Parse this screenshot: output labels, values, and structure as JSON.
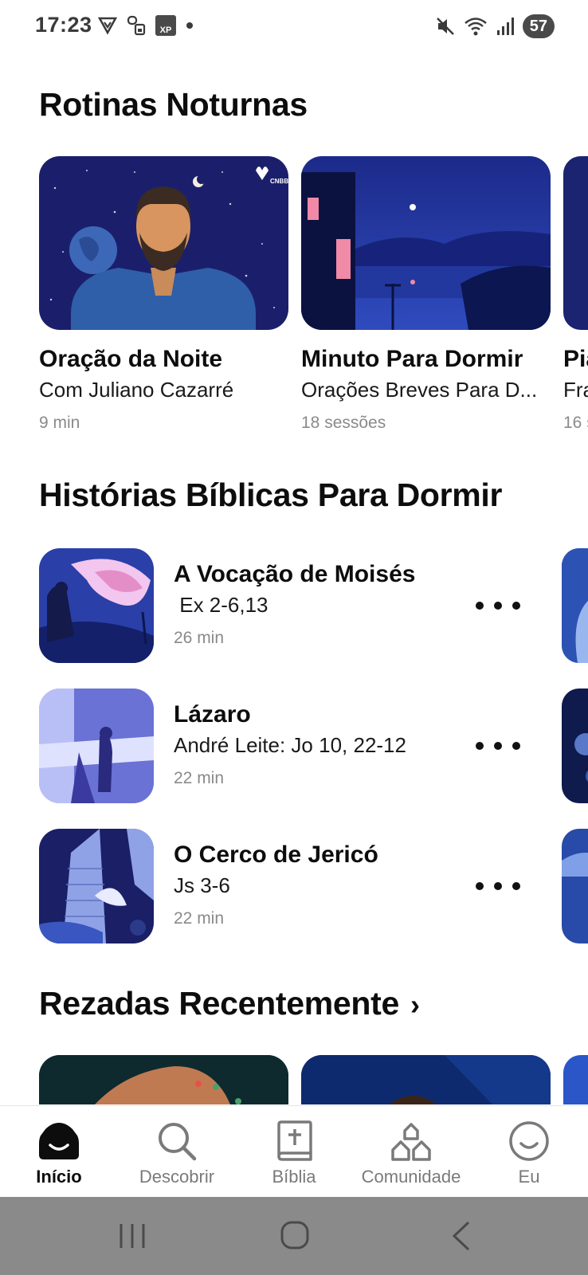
{
  "status_bar": {
    "time": "17:23",
    "battery": "57",
    "left_icons": [
      "vpn-icon",
      "sim-icon",
      "xp-app-icon",
      "dot-icon"
    ],
    "right_icons": [
      "mute-icon",
      "wifi-icon",
      "signal-icon"
    ]
  },
  "sections": {
    "night_routines": {
      "title": "Rotinas Noturnas"
    },
    "bible_stories": {
      "title": "Histórias Bíblicas Para Dormir"
    },
    "recent": {
      "title": "Rezadas Recentemente"
    }
  },
  "night_routines": [
    {
      "title": "Oração da Noite",
      "subtitle": "Com Juliano Cazarré",
      "meta": "9 min",
      "badge": "CNBB"
    },
    {
      "title": "Minuto Para Dormir",
      "subtitle": "Orações Breves Para D...",
      "meta": "18 sessões"
    },
    {
      "title": "Pia",
      "subtitle": "Fra",
      "meta": "16 s"
    }
  ],
  "bible_stories": [
    {
      "title": "A Vocação de Moisés",
      "subtitle": " Ex 2-6,13",
      "duration": "26 min"
    },
    {
      "title": "Lázaro",
      "subtitle": "André Leite: Jo 10, 22-12",
      "duration": "22 min"
    },
    {
      "title": "O Cerco de Jericó",
      "subtitle": "Js 3-6",
      "duration": "22 min"
    }
  ],
  "bottom_nav": [
    {
      "label": "Início",
      "icon": "home-icon",
      "active": true
    },
    {
      "label": "Descobrir",
      "icon": "search-icon",
      "active": false
    },
    {
      "label": "Bíblia",
      "icon": "bible-icon",
      "active": false
    },
    {
      "label": "Comunidade",
      "icon": "community-icon",
      "active": false
    },
    {
      "label": "Eu",
      "icon": "profile-icon",
      "active": false
    }
  ],
  "system_nav": [
    "recents-button",
    "home-button",
    "back-button"
  ],
  "colors": {
    "night_blue": "#1b1f6b",
    "deep_navy": "#0b1240",
    "text_primary": "#0d0d0d",
    "text_secondary": "#8a8a8a"
  }
}
